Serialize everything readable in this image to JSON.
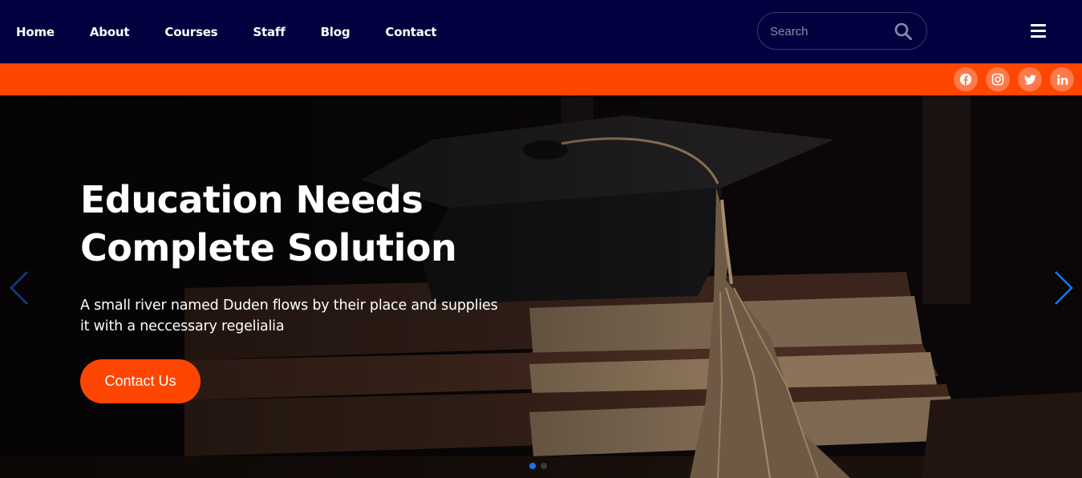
{
  "nav": {
    "links": [
      {
        "label": "Home"
      },
      {
        "label": "About"
      },
      {
        "label": "Courses"
      },
      {
        "label": "Staff"
      },
      {
        "label": "Blog"
      },
      {
        "label": "Contact"
      }
    ],
    "search_placeholder": "Search",
    "search_icon": "search-icon",
    "menu_icon": "hamburger-menu-icon"
  },
  "social": [
    "facebook-icon",
    "instagram-icon",
    "twitter-icon",
    "linkedin-icon"
  ],
  "hero": {
    "title_line1": "Education Needs",
    "title_line2": "Complete Solution",
    "text_line1": "A small river named Duden flows by their place and supplies",
    "text_line2": "it with a neccessary regelialia",
    "cta_label": "Contact Us",
    "active_slide": 1,
    "slide_count": 2
  },
  "colors": {
    "nav_bg": "#02003f",
    "accent": "#ff4600",
    "arrow": "#1774f3"
  }
}
